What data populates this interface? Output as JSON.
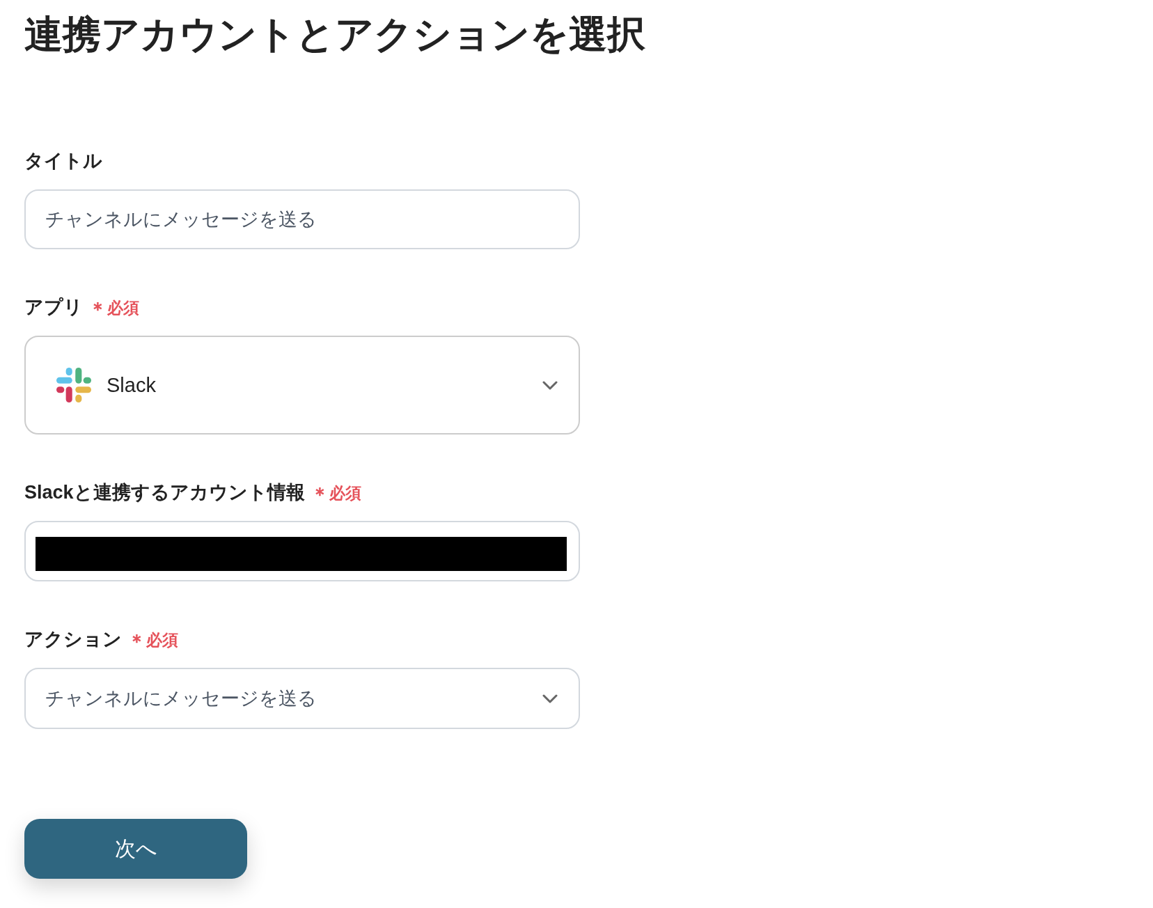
{
  "page": {
    "title": "連携アカウントとアクションを選択"
  },
  "fields": [
    {
      "kind": "input",
      "label": "タイトル",
      "value": "チャンネルにメッセージを送る",
      "redacted": false
    },
    {
      "kind": "app-select",
      "label": "アプリ",
      "required_mark": "＊",
      "required_text": "必須",
      "value": "Slack"
    },
    {
      "kind": "input",
      "label": "Slackと連携するアカウント情報",
      "required_mark": "＊",
      "required_text": "必須",
      "redacted": true
    },
    {
      "kind": "select",
      "label": "アクション",
      "required_mark": "＊",
      "required_text": "必須",
      "value": "チャンネルにメッセージを送る"
    }
  ],
  "buttons": [
    {
      "label": "次へ"
    }
  ]
}
